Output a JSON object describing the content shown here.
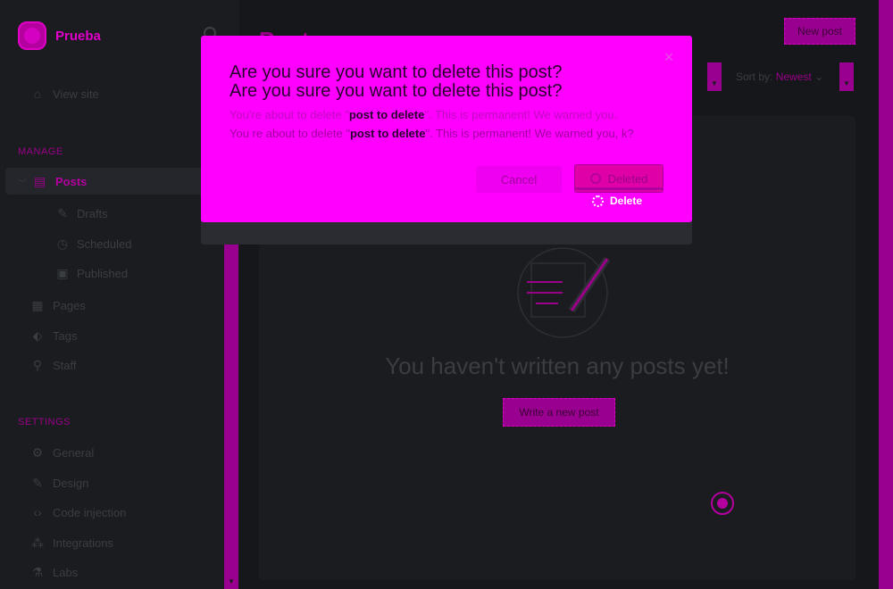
{
  "app": {
    "site_name": "Prueba"
  },
  "sidebar": {
    "view_site": "View site",
    "manage_label": "MANAGE",
    "posts_label": "Posts",
    "post_subitems": [
      "Drafts",
      "Scheduled",
      "Published"
    ],
    "manage_items": [
      "Pages",
      "Tags",
      "Staff"
    ],
    "settings_label": "SETTINGS",
    "settings_items": [
      "General",
      "Design",
      "Code injection",
      "Integrations",
      "Labs"
    ]
  },
  "header": {
    "page_title": "Posts",
    "new_post_label": "New post",
    "sort_label": "Sort by:",
    "sort_value": "Newest"
  },
  "empty_state": {
    "message": "You haven't written any posts yet!",
    "write_button": "Write a new post"
  },
  "modal": {
    "title": "Are you sure you want to delete this post?",
    "title_duplicate": "Are you sure you want to delete this post?",
    "body_prefix": "You're about to delete \"",
    "post_name": "post to delete",
    "body_suffix": "\". This is permanent! We warned you.",
    "body2_prefix": "You re about to delete \"",
    "body2_suffix": "\". This is permanent! We warned you, k?",
    "cancel_label": "Cancel",
    "deleted_label": "Deleted",
    "delete_label": "Delete"
  },
  "colors": {
    "accent": "#ff00ff",
    "sidebar_bg": "#1a1c20",
    "main_bg": "#15171a"
  }
}
